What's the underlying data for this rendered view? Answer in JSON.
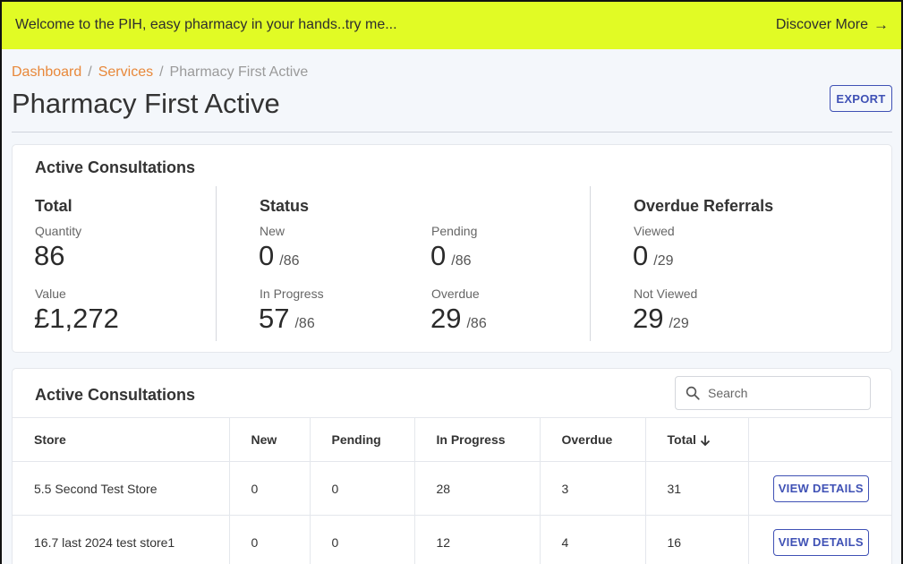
{
  "banner": {
    "message": "Welcome to the PIH, easy pharmacy in your hands..try me...",
    "discover_label": "Discover More",
    "discover_arrow": "→",
    "background": "#e1fb25"
  },
  "breadcrumb": {
    "dashboard": "Dashboard",
    "services": "Services",
    "current": "Pharmacy First Active",
    "separator": "/"
  },
  "page": {
    "title": "Pharmacy First Active",
    "export_label": "EXPORT"
  },
  "summary": {
    "title": "Active Consultations",
    "total": {
      "heading": "Total",
      "quantity_label": "Quantity",
      "quantity_value": "86",
      "value_label": "Value",
      "value_value": "£1,272"
    },
    "status": {
      "heading": "Status",
      "new_label": "New",
      "new_value": "0",
      "new_total": "/86",
      "pending_label": "Pending",
      "pending_value": "0",
      "pending_total": "/86",
      "in_progress_label": "In Progress",
      "in_progress_value": "57",
      "in_progress_total": "/86",
      "overdue_label": "Overdue",
      "overdue_value": "29",
      "overdue_total": "/86"
    },
    "referrals": {
      "heading": "Overdue Referrals",
      "viewed_label": "Viewed",
      "viewed_value": "0",
      "viewed_total": "/29",
      "not_viewed_label": "Not Viewed",
      "not_viewed_value": "29",
      "not_viewed_total": "/29"
    }
  },
  "table": {
    "title": "Active Consultations",
    "search_placeholder": "Search",
    "columns": [
      "Store",
      "New",
      "Pending",
      "In Progress",
      "Overdue",
      "Total"
    ],
    "sort_arrow": "↓",
    "action_label": "VIEW DETAILS",
    "rows": [
      [
        "5.5 Second Test Store",
        "0",
        "0",
        "28",
        "3",
        "31"
      ],
      [
        "16.7 last 2024 test store1",
        "0",
        "0",
        "12",
        "4",
        "16"
      ]
    ]
  },
  "colors": {
    "accent": "#3f51b5",
    "breadcrumb_link": "#e8883a"
  }
}
